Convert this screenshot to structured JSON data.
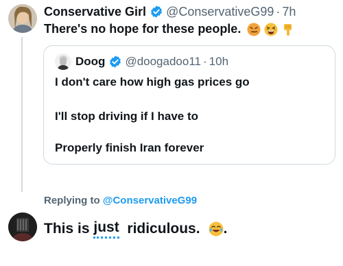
{
  "main_tweet": {
    "author_name": "Conservative Girl",
    "handle": "@ConservativeG99",
    "separator": "·",
    "time": "7h",
    "text": "There's no hope for these people.",
    "emojis": [
      "confounded-face",
      "tired-face",
      "backhand-index-pointing-down"
    ]
  },
  "quoted_tweet": {
    "author_name": "Doog",
    "handle": "@doogadoo11",
    "separator": "·",
    "time": "10h",
    "lines": [
      "I don't care how high gas prices go",
      "I'll stop driving if I have to",
      "Properly finish Iran forever"
    ]
  },
  "reply": {
    "replying_prefix": "Replying to",
    "replying_mention": "@ConservativeG99",
    "text_before": "This is",
    "text_misspelled": "just",
    "text_after": "ridiculous.",
    "emoji": "face-with-tears-of-joy",
    "text_end": "."
  },
  "colors": {
    "accent": "#1d9bf0",
    "muted": "#536471",
    "border": "#cfd9de",
    "text": "#0f1419"
  }
}
